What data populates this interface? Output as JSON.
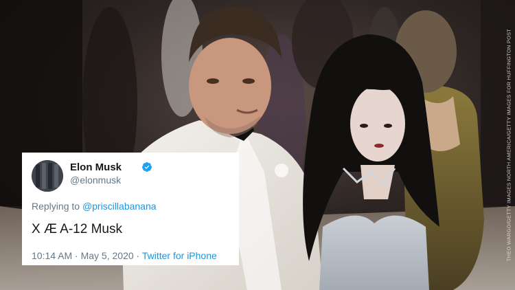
{
  "photo": {
    "credit": "THEO WARGO/GETTY IMAGES NORTH AMERICA/GETTY IMAGES FOR HUFFINGTON POST"
  },
  "tweet": {
    "display_name": "Elon Musk",
    "handle": "@elonmusk",
    "replying_prefix": "Replying to ",
    "replying_to": "@priscillabanana",
    "text": "X Æ A-12 Musk",
    "timestamp": "10:14 AM · May 5, 2020 · ",
    "source": "Twitter for iPhone",
    "verified_icon": "verified-badge-icon",
    "accent_color": "#1b95e0"
  }
}
